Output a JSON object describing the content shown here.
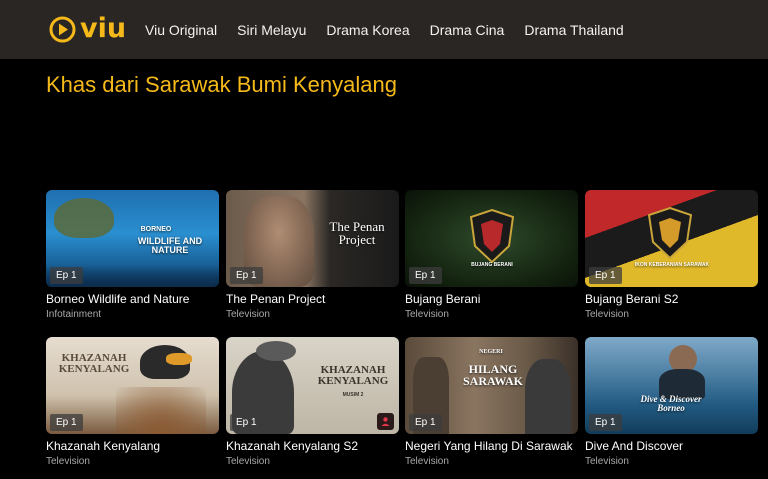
{
  "brand": {
    "name": "viu",
    "color": "#f5b919"
  },
  "nav": [
    {
      "label": "Viu Original"
    },
    {
      "label": "Siri Melayu"
    },
    {
      "label": "Drama Korea"
    },
    {
      "label": "Drama Cina"
    },
    {
      "label": "Drama Thailand"
    }
  ],
  "section": {
    "title": "Khas dari Sarawak Bumi Kenyalang"
  },
  "cards": [
    {
      "title": "Borneo Wildlife and Nature",
      "genre": "Infotainment",
      "episode": "Ep 1",
      "art_text": "WILDLIFE AND NATURE",
      "art_sub": "BORNEO"
    },
    {
      "title": "The Penan Project",
      "genre": "Television",
      "episode": "Ep 1",
      "art_text": "The Penan Project"
    },
    {
      "title": "Bujang Berani",
      "genre": "Television",
      "episode": "Ep 1",
      "art_text": "BUJANG BERANI"
    },
    {
      "title": "Bujang Berani S2",
      "genre": "Television",
      "episode": "Ep 1",
      "art_text": "IKON KEBERANIAN SARAWAK"
    },
    {
      "title": "Khazanah Kenyalang",
      "genre": "Television",
      "episode": "Ep 1",
      "art_text": "KHAZANAH KENYALANG"
    },
    {
      "title": "Khazanah Kenyalang S2",
      "genre": "Television",
      "episode": "Ep 1",
      "art_text": "KHAZANAH KENYALANG",
      "art_sub": "MUSIM 2"
    },
    {
      "title": "Negeri Yang Hilang Di Sarawak",
      "genre": "Television",
      "episode": "Ep 1",
      "art_text": "HILANG SARAWAK",
      "art_sub": "NEGERI"
    },
    {
      "title": "Dive And Discover",
      "genre": "Television",
      "episode": "Ep 1",
      "art_text": "Dive & Discover Borneo"
    }
  ],
  "icons": {
    "logo": "viu-play-logo",
    "badge": "profile-badge-icon"
  }
}
